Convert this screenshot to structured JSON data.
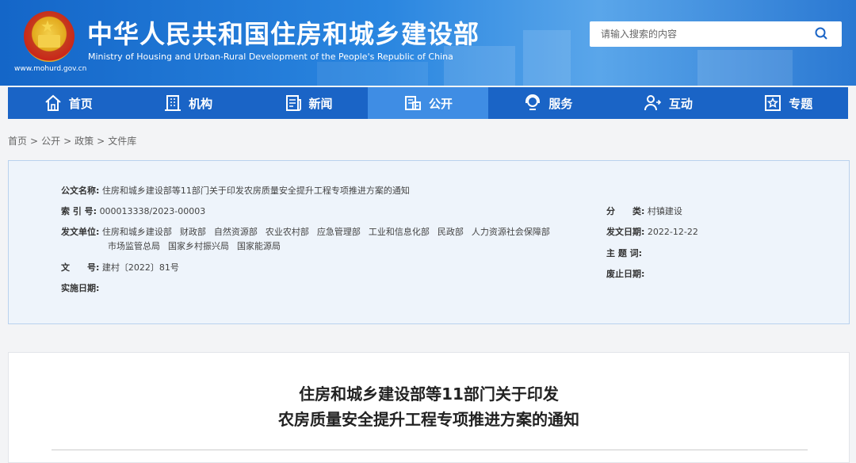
{
  "header": {
    "title_cn": "中华人民共和国住房和城乡建设部",
    "title_en": "Ministry of Housing and Urban-Rural Development of the People's Republic of China",
    "site_url": "www.mohurd.gov.cn",
    "colors": {
      "primary": "#1a64c6",
      "active_tab": "#3f8de4"
    }
  },
  "search": {
    "placeholder": "请输入搜索的内容",
    "icon": "search-icon"
  },
  "nav": {
    "items": [
      {
        "label": "首页",
        "icon": "home-icon"
      },
      {
        "label": "机构",
        "icon": "building-icon"
      },
      {
        "label": "新闻",
        "icon": "newspaper-icon"
      },
      {
        "label": "公开",
        "icon": "document-icon",
        "active": true
      },
      {
        "label": "服务",
        "icon": "service-icon"
      },
      {
        "label": "互动",
        "icon": "interaction-icon"
      },
      {
        "label": "专题",
        "icon": "star-icon"
      }
    ]
  },
  "breadcrumb": [
    "首页",
    "公开",
    "政策",
    "文件库"
  ],
  "meta": {
    "doc_name_label": "公文名称:",
    "doc_name": "住房和城乡建设部等11部门关于印发农房质量安全提升工程专项推进方案的通知",
    "index_label": "索 引 号:",
    "index": "000013338/2023-00003",
    "issuer_label": "发文单位:",
    "issuers_line1": [
      "住房和城乡建设部",
      "财政部",
      "自然资源部",
      "农业农村部",
      "应急管理部",
      "工业和信息化部",
      "民政部",
      "人力资源社会保障部"
    ],
    "issuers_line2": [
      "市场监管总局",
      "国家乡村振兴局",
      "国家能源局"
    ],
    "doc_no_label": "文　　号:",
    "doc_no": "建村〔2022〕81号",
    "effective_label": "实施日期:",
    "category_label": "分　　类:",
    "category": "村镇建设",
    "issue_date_label": "发文日期:",
    "issue_date": "2022-12-22",
    "subject_label": "主 题 词:",
    "expiry_label": "废止日期:"
  },
  "article": {
    "title_line1": "住房和城乡建设部等11部门关于印发",
    "title_line2": "农房质量安全提升工程专项推进方案的通知"
  }
}
